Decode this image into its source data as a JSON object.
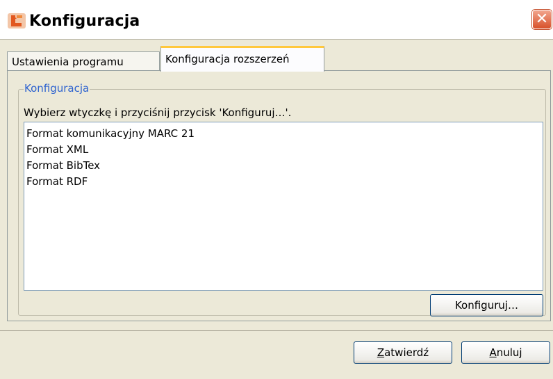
{
  "window": {
    "title": "Konfiguracja",
    "close_label": "✕"
  },
  "tabs": [
    {
      "label": "Ustawienia programu",
      "active": false
    },
    {
      "label": "Konfiguracja rozszerzeń",
      "active": true
    }
  ],
  "group": {
    "legend": "Konfiguracja",
    "instruction": "Wybierz wtyczkę i przyciśnij przycisk 'Konfiguruj…'.",
    "items": [
      "Format komunikacyjny MARC 21",
      "Format XML",
      "Format BibTex",
      "Format RDF"
    ],
    "configure_button": "Konfiguruj…"
  },
  "footer": {
    "confirm_mnemonic": "Z",
    "confirm_rest": "atwierdź",
    "cancel_mnemonic": "A",
    "cancel_rest": "nuluj"
  },
  "colors": {
    "accent": "#2d62cf",
    "tab_highlight": "#ffc83c",
    "close": "#d8502a"
  }
}
